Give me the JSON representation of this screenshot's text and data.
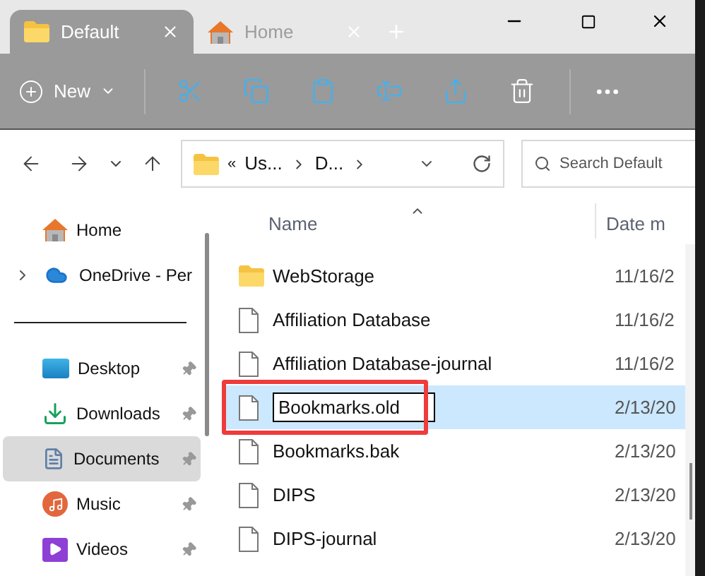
{
  "tabs": [
    {
      "label": "Default",
      "kind": "folder",
      "selected": true
    },
    {
      "label": "Home",
      "kind": "home",
      "selected": false
    }
  ],
  "toolbar": {
    "new_label": "New"
  },
  "address": {
    "overflow": "«",
    "crumbs": [
      "Us...",
      "D..."
    ]
  },
  "search": {
    "placeholder": "Search Default"
  },
  "sidebar": [
    {
      "label": "Home",
      "kind": "home",
      "pinned": false,
      "expandable": false,
      "selected": false,
      "divider_above": false
    },
    {
      "label": "OneDrive - Per",
      "kind": "cloud",
      "pinned": false,
      "expandable": true,
      "selected": false,
      "divider_above": false
    },
    {
      "label": "Desktop",
      "kind": "desktop",
      "pinned": true,
      "expandable": false,
      "selected": false,
      "divider_above": true
    },
    {
      "label": "Downloads",
      "kind": "download",
      "pinned": true,
      "expandable": false,
      "selected": false,
      "divider_above": false
    },
    {
      "label": "Documents",
      "kind": "documents",
      "pinned": true,
      "expandable": false,
      "selected": true,
      "divider_above": false
    },
    {
      "label": "Music",
      "kind": "music",
      "pinned": true,
      "expandable": false,
      "selected": false,
      "divider_above": false
    },
    {
      "label": "Videos",
      "kind": "videos",
      "pinned": true,
      "expandable": false,
      "selected": false,
      "divider_above": false
    }
  ],
  "columns": [
    "Name",
    "Date m"
  ],
  "files": [
    {
      "name": "WebStorage",
      "kind": "folder",
      "date": "11/16/2",
      "selected": false,
      "editing": false
    },
    {
      "name": "Affiliation Database",
      "kind": "file",
      "date": "11/16/2",
      "selected": false,
      "editing": false
    },
    {
      "name": "Affiliation Database-journal",
      "kind": "file",
      "date": "11/16/2",
      "selected": false,
      "editing": false
    },
    {
      "name": "Bookmarks.old",
      "kind": "file",
      "date": "2/13/20",
      "selected": true,
      "editing": true
    },
    {
      "name": "Bookmarks.bak",
      "kind": "file",
      "date": "2/13/20",
      "selected": false,
      "editing": false
    },
    {
      "name": "DIPS",
      "kind": "file",
      "date": "2/13/20",
      "selected": false,
      "editing": false
    },
    {
      "name": "DIPS-journal",
      "kind": "file",
      "date": "2/13/20",
      "selected": false,
      "editing": false
    }
  ]
}
